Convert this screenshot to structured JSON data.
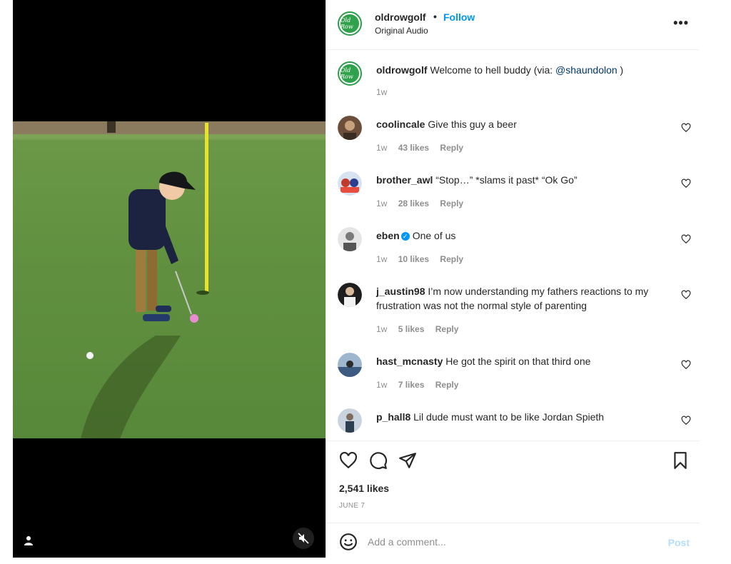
{
  "post": {
    "username": "oldrowgolf",
    "follow_label": "Follow",
    "audio": "Original Audio",
    "logo_text": "Old Row",
    "likes": "2,541 likes",
    "date": "JUNE 7"
  },
  "caption": {
    "username": "oldrowgolf",
    "text": "Welcome to hell buddy (via: ",
    "mention": "@shaundolon",
    "suffix": " )",
    "time": "1w"
  },
  "comments": [
    {
      "username": "coolincale",
      "text": "Give this guy a beer",
      "time": "1w",
      "likes": "43 likes",
      "reply": "Reply",
      "avatar_color": "#6b4f3a"
    },
    {
      "username": "brother_awl",
      "text": "“Stop…” *slams it past* “Ok Go”",
      "time": "1w",
      "likes": "28 likes",
      "reply": "Reply",
      "avatar_color": "#c0392b"
    },
    {
      "username": "eben",
      "text": "One of us",
      "time": "1w",
      "likes": "10 likes",
      "reply": "Reply",
      "avatar_color": "#8a8a8a"
    },
    {
      "username": "j_austin98",
      "text": "I’m now understanding my fathers reactions to my frustration was not the normal style of parenting",
      "time": "1w",
      "likes": "5 likes",
      "reply": "Reply",
      "avatar_color": "#2b2b2b"
    },
    {
      "username": "hast_mcnasty",
      "text": "He got the spirit on that third one",
      "time": "1w",
      "likes": "7 likes",
      "reply": "Reply",
      "avatar_color": "#3d5a80"
    },
    {
      "username": "p_hall8",
      "text": "Lil dude must want to be like Jordan Spieth",
      "time": "1w",
      "likes": "",
      "reply": "",
      "avatar_color": "#7d8ea3"
    }
  ],
  "add_comment": {
    "placeholder": "Add a comment...",
    "post_label": "Post"
  },
  "colors": {
    "accent": "#0095f6",
    "brand_green": "#2c9c4a",
    "muted": "#8e8e8e"
  },
  "icons": [
    "like-icon",
    "comment-icon",
    "share-icon",
    "bookmark-icon",
    "emoji-icon",
    "more-icon",
    "mute-icon",
    "user-tag-icon",
    "heart-icon"
  ]
}
